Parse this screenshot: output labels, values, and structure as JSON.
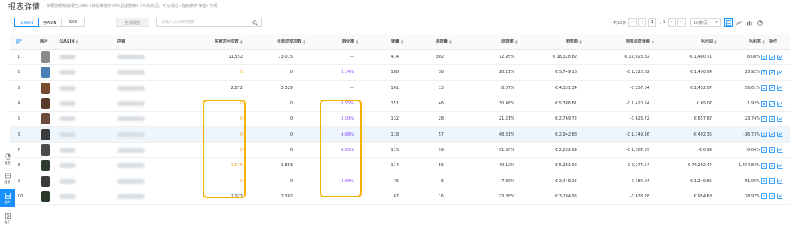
{
  "header": {
    "title": "报表详情",
    "note": "如果您想知道哪些ASIN<转化率低于20%且退款率>5%的商品，可以通过+指标条件筛选+实现"
  },
  "toolbar": {
    "tabs": [
      {
        "label": "父ASIN",
        "active": true
      },
      {
        "label": "子ASIN",
        "active": false
      },
      {
        "label": "SKU",
        "active": false
      }
    ],
    "generate_label": "生成报告",
    "search_placeholder": "请输入父ASIN搜索"
  },
  "pager": {
    "total": "共10条",
    "page": "1",
    "page_info": "/ 1",
    "page_size": "10条/页"
  },
  "columns": [
    "图片",
    "父ASIN",
    "店铺",
    "买家访问次数",
    "页面浏览次数",
    "转化率",
    "销量",
    "退款量",
    "退款率",
    "销售额",
    "销售退款金额",
    "毛利润",
    "毛利率",
    "操作"
  ],
  "rows": [
    {
      "idx": "1",
      "visits": "11,552",
      "views": "13,015",
      "conv": "—",
      "sales": "414",
      "refunds": "302",
      "refund_rate": "72.95%",
      "revenue": "€ 18,328.82",
      "refund_amt": "-€ 12,023.32",
      "profit": "-€ 1,480.71",
      "margin": "-8.08%",
      "thumb": "#8a8a8a"
    },
    {
      "idx": "2",
      "visits": "0",
      "views": "0",
      "conv": "3.14%",
      "sales": "188",
      "refunds": "38",
      "refund_rate": "20.21%",
      "revenue": "€ 5,749.18",
      "refund_amt": "-€ 1,320.62",
      "profit": "€ 1,490.04",
      "margin": "25.92%",
      "thumb": "#4a7fb5"
    },
    {
      "idx": "3",
      "visits": "2,872",
      "views": "3,329",
      "conv": "—",
      "sales": "161",
      "refunds": "13",
      "refund_rate": "8.07%",
      "revenue": "€ 4,331.34",
      "refund_amt": "-€ 257.04",
      "profit": "€ 2,452.07",
      "margin": "56.61%",
      "thumb": "#7a4a2e"
    },
    {
      "idx": "4",
      "visits": "0",
      "views": "0",
      "conv": "3.55%",
      "sales": "151",
      "refunds": "46",
      "refund_rate": "30.46%",
      "revenue": "€ 5,386.81",
      "refund_amt": "-€ 1,420.54",
      "profit": "€ 65.07",
      "margin": "1.92%",
      "thumb": "#5a3a2a"
    },
    {
      "idx": "5",
      "visits": "0",
      "views": "0",
      "conv": "3.50%",
      "sales": "132",
      "refunds": "28",
      "refund_rate": "21.21%",
      "revenue": "€ 2,769.72",
      "refund_amt": "-€ 623.72",
      "profit": "€ 657.67",
      "margin": "23.74%",
      "thumb": "#6b4a3a"
    },
    {
      "idx": "6",
      "visits": "0",
      "views": "0",
      "conv": "4.68%",
      "sales": "118",
      "refunds": "57",
      "refund_rate": "48.31%",
      "revenue": "€ 2,942.88",
      "refund_amt": "-€ 1,749.36",
      "profit": "-€ 492.35",
      "margin": "-16.73%",
      "thumb": "#3a3a3a"
    },
    {
      "idx": "7",
      "visits": "0",
      "views": "0",
      "conv": "4.05%",
      "sales": "115",
      "refunds": "59",
      "refund_rate": "51.30%",
      "revenue": "€ 2,292.89",
      "refund_amt": "-€ 1,367.05",
      "profit": "-€ 0.99",
      "margin": "-0.04%",
      "thumb": "#4a4a4a"
    },
    {
      "idx": "8",
      "visits": "1,575",
      "views": "1,853",
      "conv": "—",
      "sales": "114",
      "refunds": "56",
      "refund_rate": "49.12%",
      "revenue": "€ 5,281.92",
      "refund_amt": "-€ 2,274.54",
      "profit": "-€ 74,202.44",
      "margin": "-1,404.84%",
      "thumb": "#2e3a2e"
    },
    {
      "idx": "9",
      "visits": "0",
      "views": "0",
      "conv": "4.09%",
      "sales": "76",
      "refunds": "6",
      "refund_rate": "7.89%",
      "revenue": "€ 2,448.25",
      "refund_amt": "-€ 184.94",
      "profit": "€ 1,249.85",
      "margin": "51.05%",
      "thumb": "#3a3a3a"
    },
    {
      "idx": "10",
      "visits": "2,023",
      "views": "2,302",
      "conv": "—",
      "sales": "67",
      "refunds": "16",
      "refund_rate": "23.88%",
      "revenue": "€ 3,294.96",
      "refund_amt": "-€ 638.28",
      "profit": "€ 954.68",
      "margin": "28.97%",
      "thumb": "#2a3a2a"
    }
  ],
  "sidenav": [
    {
      "label": "报报",
      "active": false
    },
    {
      "label": "报表",
      "active": false
    },
    {
      "label": "我的",
      "active": true
    },
    {
      "label": "展开",
      "active": false
    }
  ],
  "colors": {
    "accent": "#1890ff",
    "highlight_box": "#f5b300",
    "orange_value": "#f5a623",
    "purple_value": "#8a3ffc",
    "row_highlight": "#ecf6fc"
  }
}
